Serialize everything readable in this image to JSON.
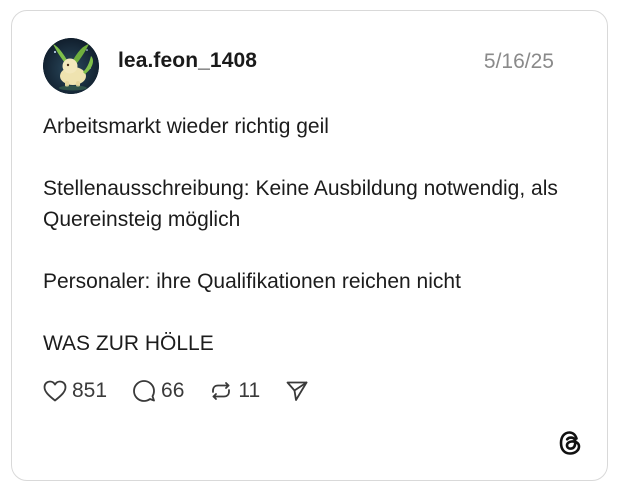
{
  "post": {
    "username": "lea.feon_1408",
    "date": "5/16/25",
    "paragraphs": [
      "Arbeitsmarkt wieder richtig geil",
      "Stellenausschreibung: Keine Ausbildung notwendig, als Quereinsteig möglich",
      "Personaler: ihre Qualifikationen reichen nicht",
      "WAS ZUR HÖLLE"
    ]
  },
  "actions": {
    "likes": "851",
    "comments": "66",
    "reposts": "11"
  },
  "icons": {
    "like": "heart-icon",
    "comment": "comment-bubble-icon",
    "repost": "repost-icon",
    "share": "send-icon",
    "logo": "threads-logo-icon"
  },
  "colors": {
    "text": "#1c1c1c",
    "date": "#8a8a8a",
    "border": "#d9d9d9",
    "icon": "#3a3a3a"
  }
}
